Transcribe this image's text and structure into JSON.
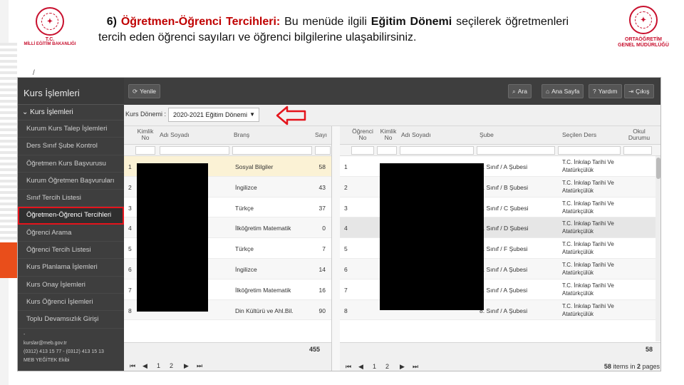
{
  "slide": {
    "caption_num": "6)",
    "caption_title": "Öğretmen-Öğrenci Tercihleri:",
    "caption_part1": "Bu menüde ilgili",
    "caption_bold": "Eğitim Dönemi",
    "caption_part2": "seçilerek öğretmenleri tercih eden öğrenci sayıları ve öğrenci bilgilerine ulaşabilirsiniz.",
    "logo_left_line1": "T.C.",
    "logo_left_line2": "MİLLİ EĞİTİM BAKANLIĞI",
    "logo_right_line1": "ORTAÖĞRETİM",
    "logo_right_line2": "GENEL MÜDÜRLÜĞÜ",
    "stray_mark": "/",
    "colors": {
      "accent_red": "#c00000",
      "sidebar_bg": "#3e3e3e",
      "selected_row": "#fbf2d5"
    }
  },
  "app": {
    "sidebar": {
      "title": "Kurs İşlemleri",
      "group": "Kurs İşlemleri",
      "items": [
        "Kurum Kurs Talep İşlemleri",
        "Ders Sınıf Şube Kontrol",
        "Öğretmen Kurs Başvurusu",
        "Kurum Öğretmen Başvuruları",
        "Sınıf Tercih Listesi",
        "Öğretmen-Öğrenci Tercihleri",
        "Öğrenci Arama",
        "Öğrenci Tercih Listesi",
        "Kurs Planlama İşlemleri",
        "Kurs Onay İşlemleri",
        "Kurs Öğrenci İşlemleri",
        "Toplu Devamsızlık Girişi"
      ],
      "dash": "-",
      "footer_email": "kurslar@meb.gov.tr",
      "footer_phone": "(0312) 413 15 77 - (0312) 413 15 13",
      "footer_copy": "MEB YEĞİTEK Ekibi"
    },
    "toolbar": {
      "refresh": "Yenile",
      "search": "Ara",
      "home": "Ana Sayfa",
      "help": "Yardım",
      "exit": "Çıkış"
    },
    "filter": {
      "label": "Kurs Dönemi :",
      "selected": "2020-2021 Eğitim Dönemi"
    },
    "left_grid": {
      "headers": [
        "Kimlik No",
        "Adı Soyadı",
        "Branş",
        "Sayı"
      ],
      "rows": [
        {
          "n": "1",
          "brans": "Sosyal Bilgiler",
          "sayi": "58"
        },
        {
          "n": "2",
          "brans": "İngilizce",
          "sayi": "43"
        },
        {
          "n": "3",
          "brans": "Türkçe",
          "sayi": "37"
        },
        {
          "n": "4",
          "brans": "İlköğretim Matematik",
          "sayi": "0"
        },
        {
          "n": "5",
          "brans": "Türkçe",
          "sayi": "7"
        },
        {
          "n": "6",
          "brans": "İngilizce",
          "sayi": "14"
        },
        {
          "n": "7",
          "brans": "İlköğretim Matematik",
          "sayi": "16"
        },
        {
          "n": "8",
          "brans": "Din Kültürü ve Ahl.Bil.",
          "sayi": "90"
        }
      ],
      "total": "455",
      "pager": {
        "first": "⏮",
        "prev": "◀",
        "p1": "1",
        "p2": "2",
        "next": "▶",
        "last": "⏭"
      }
    },
    "right_grid": {
      "headers": [
        "Öğrenci No",
        "Kimlik No",
        "Adı Soyadı",
        "Şube",
        "Seçilen Ders",
        "Okul Durumu"
      ],
      "rows": [
        {
          "n": "1",
          "sube": "8. Sınıf / A Şubesi",
          "ders": "T.C. İnkılap Tarihi Ve Atatürkçülük"
        },
        {
          "n": "2",
          "sube": "8. Sınıf / B Şubesi",
          "ders": "T.C. İnkılap Tarihi Ve Atatürkçülük"
        },
        {
          "n": "3",
          "sube": "8. Sınıf / C Şubesi",
          "ders": "T.C. İnkılap Tarihi Ve Atatürkçülük"
        },
        {
          "n": "4",
          "sube": "8. Sınıf / D Şubesi",
          "ders": "T.C. İnkılap Tarihi Ve Atatürkçülük"
        },
        {
          "n": "5",
          "sube": "8. Sınıf / F Şubesi",
          "ders": "T.C. İnkılap Tarihi Ve Atatürkçülük"
        },
        {
          "n": "6",
          "sube": "8. Sınıf / A Şubesi",
          "ders": "T.C. İnkılap Tarihi Ve Atatürkçülük"
        },
        {
          "n": "7",
          "sube": "8. Sınıf / A Şubesi",
          "ders": "T.C. İnkılap Tarihi Ve Atatürkçülük"
        },
        {
          "n": "8",
          "sube": "8. Sınıf / A Şubesi",
          "ders": "T.C. İnkılap Tarihi Ve Atatürkçülük"
        }
      ],
      "total": "58",
      "pager": {
        "first": "⏮",
        "prev": "◀",
        "p1": "1",
        "p2": "2",
        "next": "▶",
        "last": "⏭"
      },
      "items_count": "58",
      "items_pages": "2",
      "items_text1": "items in",
      "items_text2": "pages"
    }
  }
}
